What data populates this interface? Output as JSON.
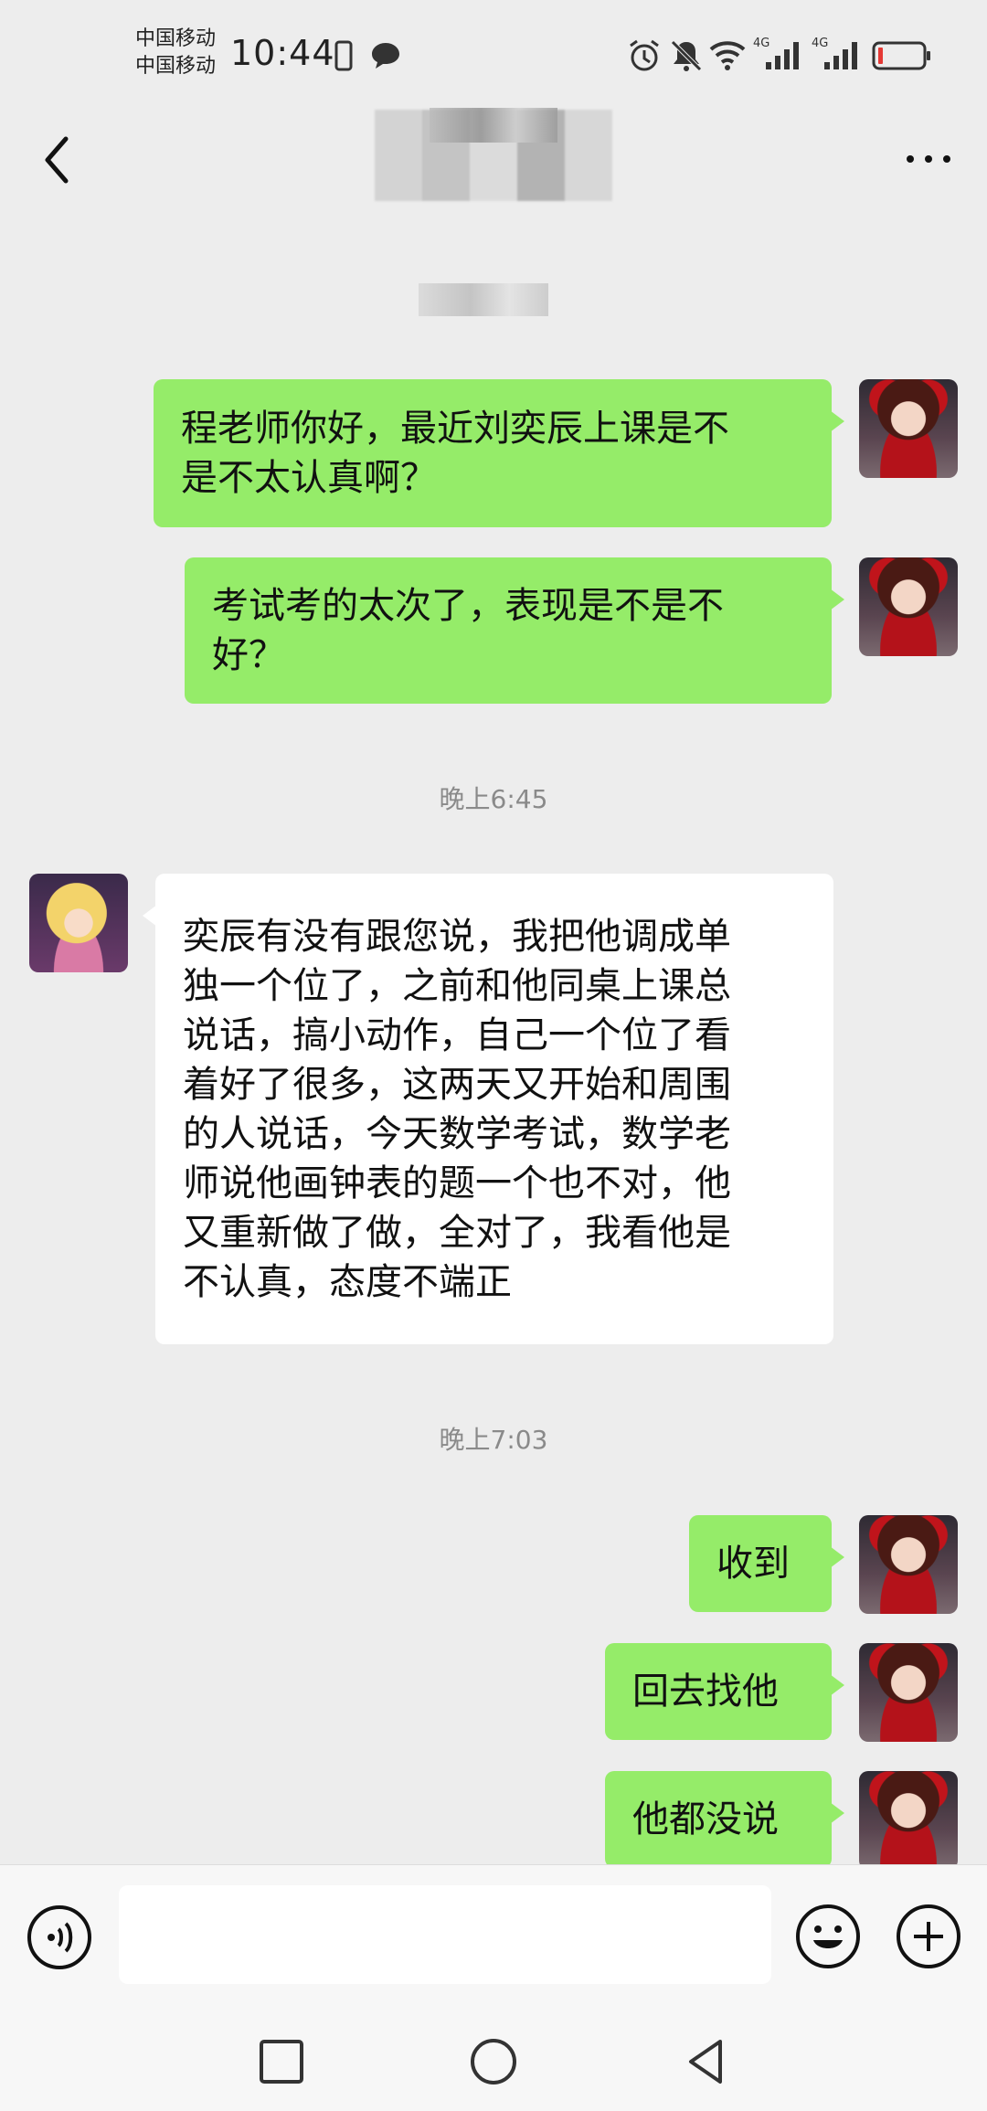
{
  "status_bar": {
    "carrier_1": "中国移动",
    "carrier_2": "中国移动",
    "time": "10:44",
    "network_1": "4G",
    "network_2": "4G"
  },
  "header": {
    "back_icon": "chevron-left-icon",
    "more_icon": "more-horizontal-icon"
  },
  "messages": [
    {
      "side": "me",
      "text": "程老师你好，最近刘奕辰上课是不\n是不太认真啊？"
    },
    {
      "side": "me",
      "text": "考试考的太次了，表现是不是不\n好？"
    },
    {
      "timestamp": "晚上6:45"
    },
    {
      "side": "other",
      "text": "奕辰有没有跟您说，我把他调成单\n独一个位了，之前和他同桌上课总\n说话，搞小动作，自己一个位了看\n着好了很多，这两天又开始和周围\n的人说话，今天数学考试，数学老\n师说他画钟表的题一个也不对，他\n又重新做了做，全对了，我看他是\n不认真，态度不端正"
    },
    {
      "timestamp": "晚上7:03"
    },
    {
      "side": "me",
      "text": "收到"
    },
    {
      "side": "me",
      "text": "回去找他"
    },
    {
      "side": "me",
      "text": "他都没说"
    }
  ],
  "input_bar": {
    "voice_icon": "voice-icon",
    "placeholder": "",
    "emoji_icon": "emoji-icon",
    "plus_icon": "plus-icon"
  },
  "colors": {
    "my_bubble": "#95ec69",
    "other_bubble": "#ffffff",
    "background": "#ededed"
  }
}
